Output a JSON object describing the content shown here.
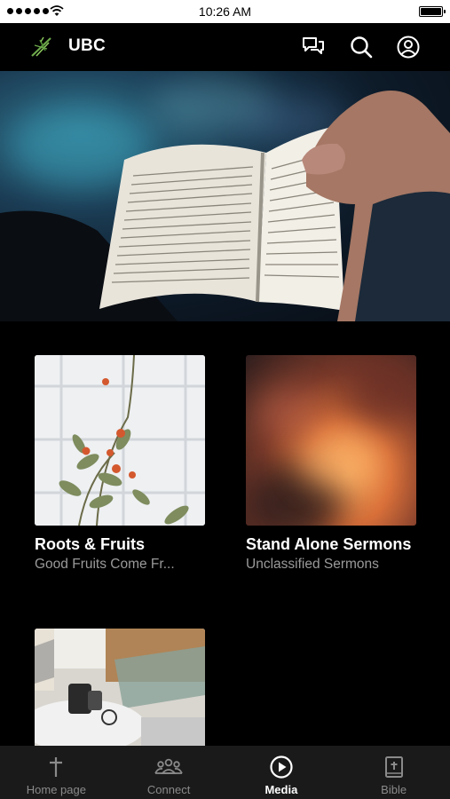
{
  "status_bar": {
    "time": "10:26 AM"
  },
  "header": {
    "title": "UBC",
    "icons": [
      "chat-icon",
      "search-icon",
      "account-icon"
    ]
  },
  "cards": [
    {
      "title": "Roots & Fruits",
      "subtitle": "Good Fruits Come Fr..."
    },
    {
      "title": "Stand Alone Sermons",
      "subtitle": "Unclassified Sermons"
    },
    {
      "title": "",
      "subtitle": ""
    }
  ],
  "bottom_nav": [
    {
      "label": "Home page",
      "icon": "cross-icon",
      "active": false
    },
    {
      "label": "Connect",
      "icon": "people-icon",
      "active": false
    },
    {
      "label": "Media",
      "icon": "play-circle-icon",
      "active": true
    },
    {
      "label": "Bible",
      "icon": "bible-icon",
      "active": false
    }
  ],
  "colors": {
    "background": "#000000",
    "nav_background": "#1a1a1a",
    "subtitle": "#9a9a9a",
    "inactive_nav": "#8a8a8a"
  }
}
